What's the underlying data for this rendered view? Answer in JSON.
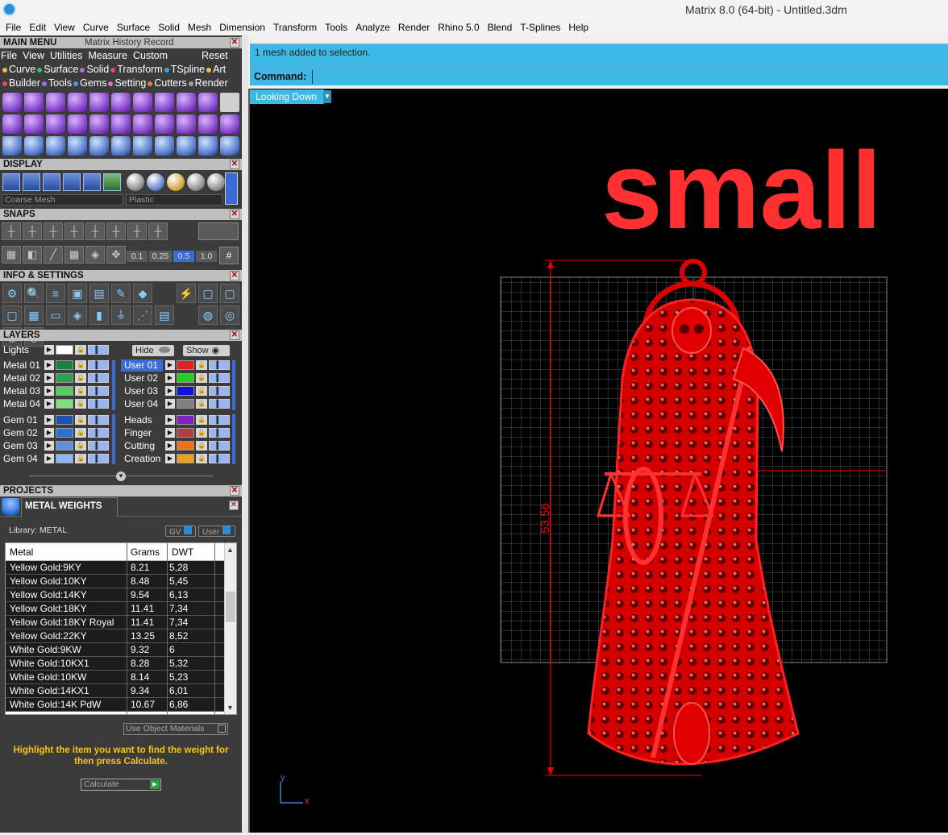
{
  "window": {
    "title": "Matrix 8.0 (64-bit) - Untitled.3dm"
  },
  "menubar": [
    "File",
    "Edit",
    "View",
    "Curve",
    "Surface",
    "Solid",
    "Mesh",
    "Dimension",
    "Transform",
    "Tools",
    "Analyze",
    "Render",
    "Rhino 5.0",
    "Blend",
    "T-Splines",
    "Help"
  ],
  "main_menu": {
    "title": "MAIN MENU",
    "subtitle": "Matrix History Record",
    "menu_row": [
      "File",
      "View",
      "Utilities",
      "Measure",
      "Custom"
    ],
    "reset_label": "Reset",
    "categories_row1": [
      {
        "label": "Curve",
        "color": "#f0c040"
      },
      {
        "label": "Surface",
        "color": "#3cc070"
      },
      {
        "label": "Solid",
        "color": "#b070e0"
      },
      {
        "label": "Transform",
        "color": "#e05050"
      },
      {
        "label": "TSpline",
        "color": "#40a0e0"
      },
      {
        "label": "Art",
        "color": "#f0c040"
      }
    ],
    "categories_row2": [
      {
        "label": "Builder",
        "color": "#e05050"
      },
      {
        "label": "Tools",
        "color": "#a070e0"
      },
      {
        "label": "Gems",
        "color": "#40a0e0"
      },
      {
        "label": "Setting",
        "color": "#e070c0"
      },
      {
        "label": "Cutters",
        "color": "#f08040"
      },
      {
        "label": "Render",
        "color": "#a0a0a0"
      }
    ]
  },
  "display": {
    "title": "DISPLAY",
    "mesh_select": "Coarse Mesh",
    "material_select": "Plastic"
  },
  "snaps": {
    "title": "SNAPS",
    "increments": [
      "0.1",
      "0.25",
      "0.5",
      "1.0"
    ]
  },
  "info_settings": {
    "title": "INFO & SETTINGS"
  },
  "layers": {
    "title": "LAYERS",
    "lights_label": "Lights",
    "hide_label": "Hide",
    "show_label": "Show",
    "left": [
      {
        "name": "Metal 01",
        "color": "#1a8040"
      },
      {
        "name": "Metal 02",
        "color": "#30a050"
      },
      {
        "name": "Metal 03",
        "color": "#50d060"
      },
      {
        "name": "Metal 04",
        "color": "#80e080"
      },
      {
        "name": "Gem 01",
        "color": "#2050b0"
      },
      {
        "name": "Gem 02",
        "color": "#3070d0"
      },
      {
        "name": "Gem 03",
        "color": "#6090e0"
      },
      {
        "name": "Gem 04",
        "color": "#90b8f0"
      }
    ],
    "right": [
      {
        "name": "User 01",
        "color": "#e02020"
      },
      {
        "name": "User 02",
        "color": "#20d020"
      },
      {
        "name": "User 03",
        "color": "#1010e0"
      },
      {
        "name": "User 04",
        "color": "#808080"
      },
      {
        "name": "Heads",
        "color": "#8020c0"
      },
      {
        "name": "Finger",
        "color": "#b04040"
      },
      {
        "name": "Cutting",
        "color": "#f07020"
      },
      {
        "name": "Creation",
        "color": "#f0a020"
      }
    ]
  },
  "projects": {
    "title": "PROJECTS"
  },
  "metal_weights": {
    "title": "METAL WEIGHTS",
    "library_label": "Library: METAL",
    "gv_label": "GV",
    "user_label": "User",
    "columns": [
      "Metal",
      "Grams",
      "DWT"
    ],
    "rows": [
      [
        "Yellow Gold:9KY",
        "8.21",
        "5,28"
      ],
      [
        "Yellow Gold:10KY",
        "8.48",
        "5,45"
      ],
      [
        "Yellow Gold:14KY",
        "9.54",
        "6,13"
      ],
      [
        "Yellow Gold:18KY",
        "11.41",
        "7,34"
      ],
      [
        "Yellow Gold:18KY Royal",
        "11.41",
        "7,34"
      ],
      [
        "Yellow Gold:22KY",
        "13.25",
        "8,52"
      ],
      [
        "White Gold:9KW",
        "9.32",
        "6"
      ],
      [
        "White Gold:10KX1",
        "8.28",
        "5,32"
      ],
      [
        "White Gold:10KW",
        "8.14",
        "5,23"
      ],
      [
        "White Gold:14KX1",
        "9.34",
        "6,01"
      ],
      [
        "White Gold:14K PdW",
        "10.67",
        "6,86"
      ]
    ],
    "use_object_materials": "Use Object Materials",
    "hint": "Highlight the item you want to find the weight for then press Calculate.",
    "calculate_label": "Calculate"
  },
  "command": {
    "message": "1 mesh added to selection.",
    "label": "Command:",
    "value": ""
  },
  "viewport": {
    "view_name": "Looking Down",
    "big_text": "small",
    "dimension": "53.56",
    "axis_y": "y",
    "axis_x": "x",
    "model_color": "#e00000"
  }
}
